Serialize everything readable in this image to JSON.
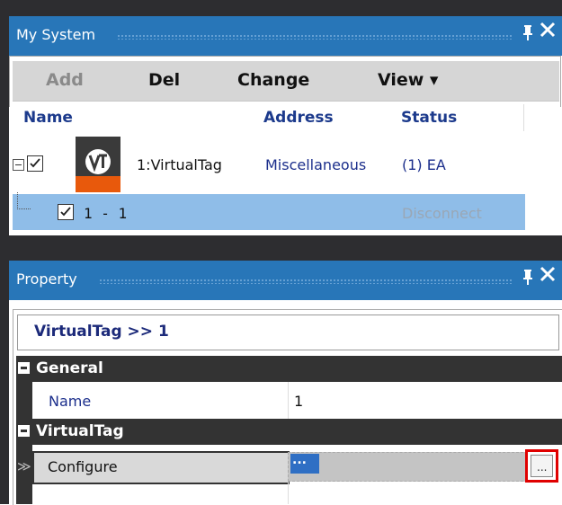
{
  "my_system": {
    "title": "My System",
    "pin_glyph": "ᵖ",
    "pin_text": "ɸ",
    "pin": "ꟼ",
    "close": "✕",
    "toolbar": {
      "add": "Add",
      "del": "Del",
      "change": "Change",
      "view": "View ▾"
    },
    "columns": {
      "name": "Name",
      "address": "Address",
      "status": "Status"
    },
    "rows": [
      {
        "label": "1:VirtualTag",
        "address": "Miscellaneous",
        "status": "(1) EA",
        "checked": true,
        "expanded": true
      },
      {
        "label": "1 - 1",
        "address": "",
        "status": "Disconnect",
        "checked": true,
        "selected": true
      }
    ]
  },
  "property": {
    "title": "Property",
    "pin": "ꟼ",
    "close": "✕",
    "header": "VirtualTag >> 1",
    "categories": [
      {
        "label": "General",
        "items": [
          {
            "name": "Name",
            "value": "1"
          }
        ]
      },
      {
        "label": "VirtualTag",
        "items": [
          {
            "name": "Configure",
            "value": "...",
            "button": "..."
          }
        ]
      }
    ]
  },
  "colors": {
    "titlebar": "#2876b8",
    "chrome": "#2d2d30",
    "selected_row": "#8fbde8",
    "column_header": "#1c3a8c",
    "highlight_border": "#e00000"
  },
  "icons": {
    "pin": "pin-icon",
    "close": "close-icon",
    "collapse": "minus-icon",
    "app_logo": "vt-logo-icon",
    "chevron": "chevron-down-icon"
  }
}
